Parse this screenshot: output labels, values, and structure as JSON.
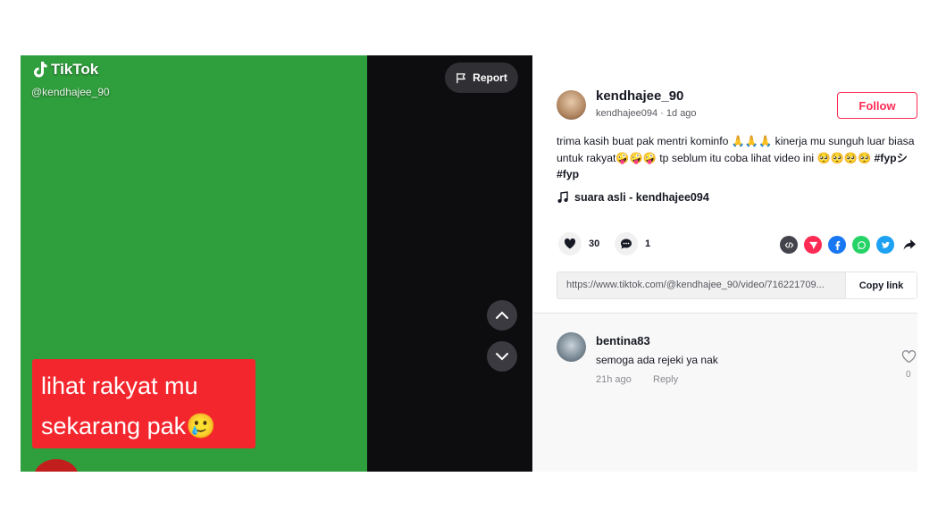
{
  "video": {
    "watermark_brand": "TikTok",
    "watermark_handle": "@kendhajee_90",
    "report_label": "Report",
    "caption_line1": "lihat rakyat mu",
    "caption_line2": "sekarang pak🥲"
  },
  "author": {
    "username": "kendhajee_90",
    "subline": "kendhajee094 · 1d ago",
    "follow_label": "Follow"
  },
  "post": {
    "description_text": "trima kasih buat pak mentri kominfo 🙏🙏🙏 kinerja mu sunguh luar biasa untuk rakyat🤪🤪🤪 tp seblum itu coba lihat video ini 🥺🥺🥺🥺 ",
    "hashtags": [
      "#fypシ",
      "#fyp"
    ],
    "music": "suara asli - kendhajee094",
    "likes": "30",
    "comments": "1",
    "link_url": "https://www.tiktok.com/@kendhajee_90/video/716221709...",
    "copy_link_label": "Copy link"
  },
  "share_icons": [
    {
      "name": "embed-icon",
      "color": "#43434b"
    },
    {
      "name": "send-icon",
      "color": "#fe2c55"
    },
    {
      "name": "facebook-icon",
      "color": "#1877f2"
    },
    {
      "name": "whatsapp-icon",
      "color": "#25d366"
    },
    {
      "name": "twitter-icon",
      "color": "#1da1f2"
    },
    {
      "name": "share-arrow-icon",
      "color": "#161823"
    }
  ],
  "comments_list": [
    {
      "username": "bentina83",
      "text": "semoga ada rejeki ya nak",
      "time": "21h ago",
      "reply_label": "Reply",
      "likes": "0"
    }
  ]
}
